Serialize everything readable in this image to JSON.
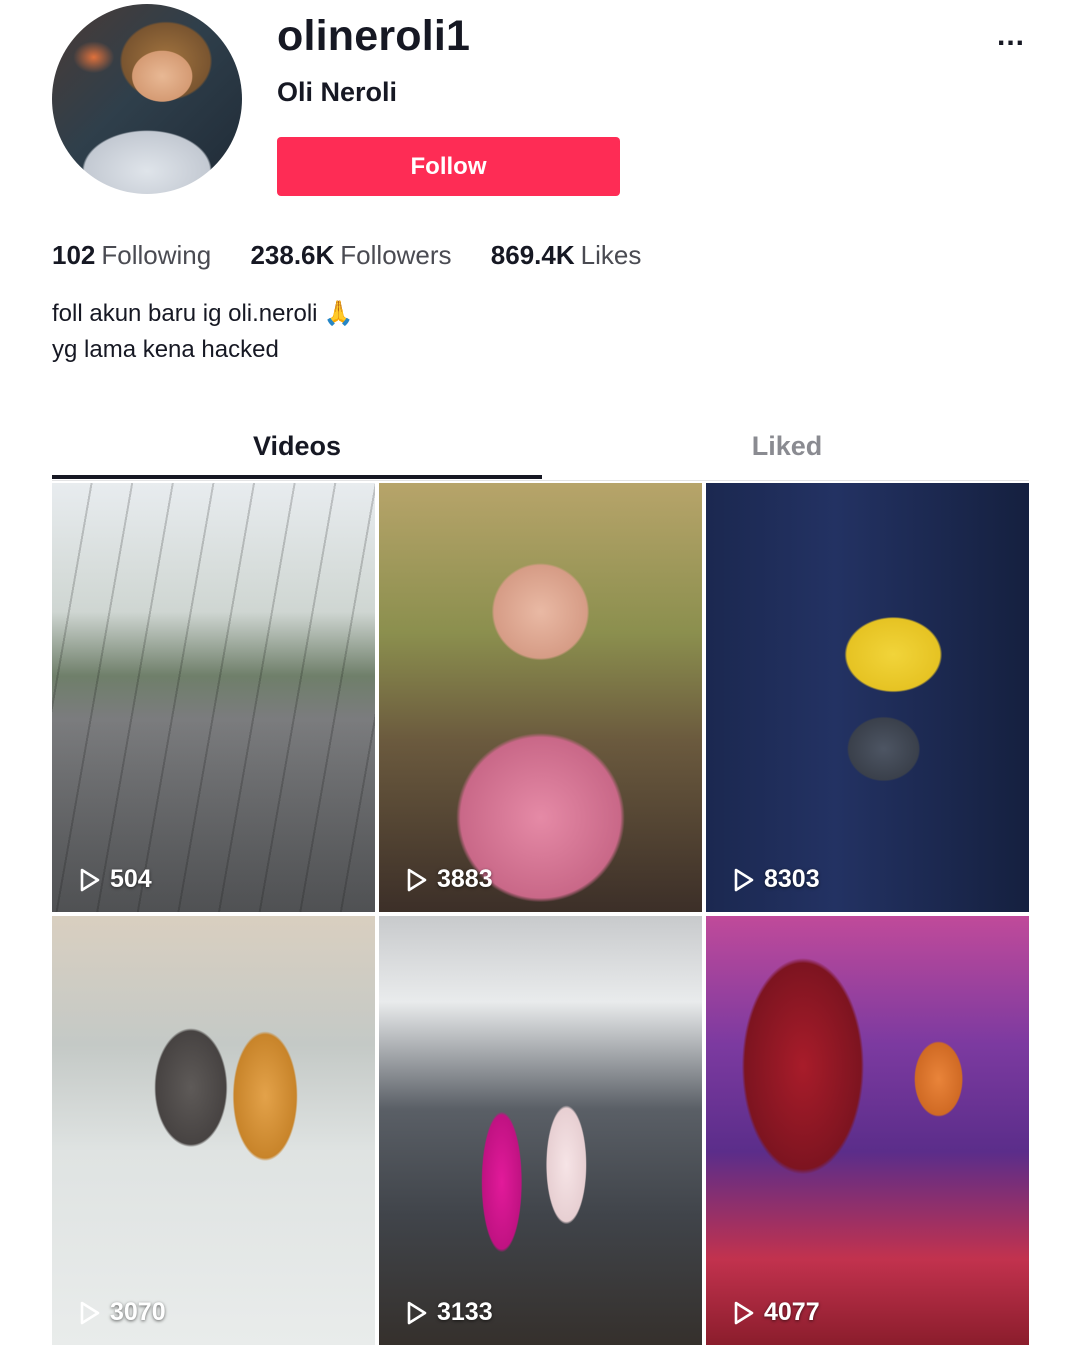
{
  "profile": {
    "username": "olineroli1",
    "nickname": "Oli Neroli",
    "follow_label": "Follow",
    "more_label": "...",
    "avatar_icon": "avatar-photo"
  },
  "stats": {
    "following": {
      "count": "102",
      "label": "Following"
    },
    "followers": {
      "count": "238.6K",
      "label": "Followers"
    },
    "likes": {
      "count": "869.4K",
      "label": "Likes"
    }
  },
  "bio": {
    "line1": "foll akun baru ig oli.neroli",
    "emoji": "🙏",
    "line2": "yg lama kena hacked"
  },
  "tabs": [
    {
      "label": "Videos",
      "active": true
    },
    {
      "label": "Liked",
      "active": false
    }
  ],
  "videos": [
    {
      "views": "504"
    },
    {
      "views": "3883"
    },
    {
      "views": "8303"
    },
    {
      "views": "3070"
    },
    {
      "views": "3133"
    },
    {
      "views": "4077"
    }
  ],
  "colors": {
    "accent": "#fe2c55",
    "text": "#161823",
    "muted": "#8a8b91"
  }
}
